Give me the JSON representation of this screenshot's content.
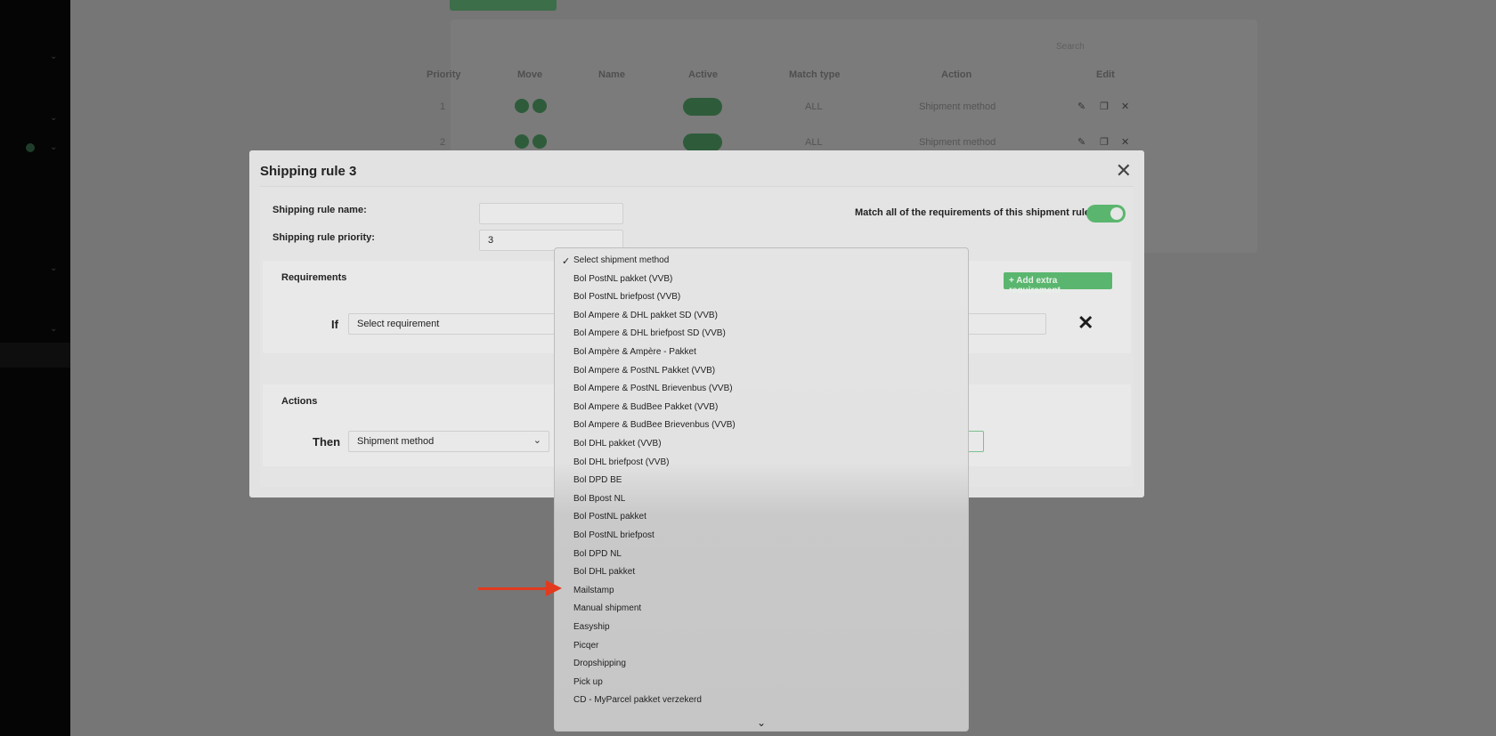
{
  "background": {
    "table_headers": [
      "Priority",
      "Move",
      "Name",
      "Active",
      "Match type",
      "Action",
      "Edit"
    ],
    "search_label": "Search",
    "rows": [
      {
        "priority": "1",
        "match_type": "ALL",
        "action": "Shipment method"
      },
      {
        "priority": "2",
        "match_type": "ALL",
        "action": "Shipment method"
      }
    ]
  },
  "modal": {
    "title": "Shipping rule 3",
    "close_icon": "close-icon",
    "name_label": "Shipping rule name:",
    "name_value": "",
    "priority_label": "Shipping rule priority:",
    "priority_value": "3",
    "match_all_label": "Match all of the requirements of this shipment rule",
    "match_all_enabled": true,
    "requirements": {
      "title": "Requirements",
      "add_button": "+ Add extra requirement",
      "if_label": "If",
      "select_placeholder": "Select requirement"
    },
    "actions": {
      "title": "Actions",
      "then_label": "Then",
      "action_value": "Shipment method"
    }
  },
  "dropdown": {
    "selected": "Select shipment method",
    "options": [
      "Select shipment method",
      "Bol PostNL pakket (VVB)",
      "Bol PostNL briefpost (VVB)",
      "Bol Ampere & DHL pakket SD (VVB)",
      "Bol Ampere & DHL briefpost SD (VVB)",
      "Bol Ampère & Ampère - Pakket",
      "Bol Ampere & PostNL Pakket (VVB)",
      "Bol Ampere & PostNL Brievenbus (VVB)",
      "Bol Ampere & BudBee Pakket (VVB)",
      "Bol Ampere & BudBee Brievenbus (VVB)",
      "Bol DHL pakket (VVB)",
      "Bol DHL briefpost (VVB)",
      "Bol DPD BE",
      "Bol Bpost NL",
      "Bol PostNL pakket",
      "Bol PostNL briefpost",
      "Bol DPD NL",
      "Bol DHL pakket",
      "Mailstamp",
      "Manual shipment",
      "Easyship",
      "Picqer",
      "Dropshipping",
      "Pick up",
      "CD - MyParcel pakket verzekerd"
    ],
    "highlighted": "Mailstamp"
  },
  "colors": {
    "accent_green": "#5ab66e",
    "arrow_red": "#e23a1f"
  }
}
